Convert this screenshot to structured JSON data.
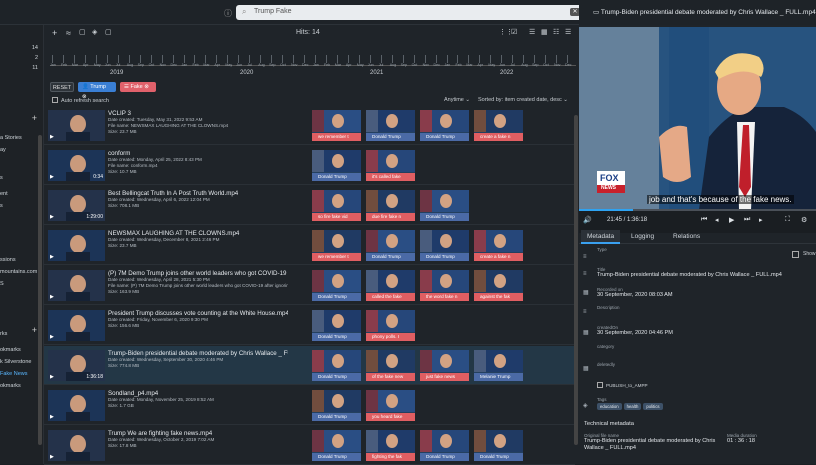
{
  "search": {
    "value": "Trump Fake"
  },
  "hits_label": "Hits: 14",
  "sidebar": {
    "rows": [
      {
        "label": "",
        "count": "14"
      },
      {
        "label": "",
        "count": "2"
      },
      {
        "label": "",
        "count": "11"
      },
      {
        "label": "a Stories",
        "count": ""
      },
      {
        "label": "ay",
        "count": ""
      },
      {
        "label": "s",
        "count": ""
      },
      {
        "label": "ent",
        "count": ""
      },
      {
        "label": "s",
        "count": ""
      },
      {
        "label": "ssions",
        "count": ""
      },
      {
        "label": "mountains.com",
        "count": ""
      },
      {
        "label": "S",
        "count": ""
      },
      {
        "label": "rks",
        "count": ""
      },
      {
        "label": "okmarks",
        "count": ""
      },
      {
        "label": "k Silverstone",
        "count": ""
      },
      {
        "label": "Fake News",
        "count": ""
      },
      {
        "label": "okmarks",
        "count": ""
      }
    ]
  },
  "timeline": {
    "years": [
      "2019",
      "2020",
      "2021",
      "2022"
    ],
    "months": [
      "Jan",
      "Feb",
      "Mar",
      "Apr",
      "May",
      "Jun",
      "Jul",
      "Aug",
      "Sep",
      "Oct",
      "Nov",
      "Dec",
      "Jan",
      "Feb",
      "Mar",
      "Apr",
      "May",
      "Jun",
      "Jul",
      "Aug",
      "Sep",
      "Oct",
      "Nov",
      "Dec",
      "Jan",
      "Feb",
      "Mar",
      "Apr",
      "May",
      "Jun",
      "Jul",
      "Aug",
      "Sep",
      "Oct",
      "Nov",
      "Dec",
      "Jan",
      "Feb",
      "Mar",
      "Apr",
      "May",
      "Jun",
      "Jul",
      "Aug",
      "Sep",
      "Oct",
      "Nov",
      "Dec"
    ]
  },
  "filters": {
    "reset": "RESET",
    "chip1": "Trump",
    "chip2": "Fake"
  },
  "auto_refresh": "Auto refresh search",
  "sort": {
    "range": "Anytime",
    "order": "Sorted by: item created date, desc"
  },
  "items": [
    {
      "title": "VCLIP 3",
      "created": "Date created: Tuesday, May 31, 2022 9:53 AM",
      "file": "File name: NEWSMAX LAUGHING AT THE CLOWNS.mp4",
      "size": "Size: 23.7 MB",
      "duration": "",
      "caps": [
        "we remember t",
        "Donald Trump",
        "Donald Trump",
        "create a fake n"
      ]
    },
    {
      "title": "conform",
      "created": "Date created: Monday, April 25, 2022 8:43 PM",
      "file": "File name: conform.mp4",
      "size": "Size: 10.7 MB",
      "duration": "0:34",
      "caps": [
        "Donald Trump",
        "it's called fake",
        "",
        ""
      ]
    },
    {
      "title": "Best Bellingcat Truth In A Post Truth World.mp4",
      "created": "Date created: Wednesday, April 6, 2022 12:04 PM",
      "file": "",
      "size": "Size: 708.1 MB",
      "duration": "1:29:00",
      "caps": [
        "so fire fake vid",
        "due fire fake n",
        "Donald Trump",
        ""
      ]
    },
    {
      "title": "NEWSMAX LAUGHING AT THE CLOWNS.mp4",
      "created": "Date created: Wednesday, December 8, 2021 2:46 PM",
      "file": "",
      "size": "Size: 23.7 MB",
      "duration": "",
      "caps": [
        "we remember t",
        "Donald Trump",
        "Donald Trump",
        "create a fake n"
      ]
    },
    {
      "title": "(P) 7M Demo Trump joins other world leaders who got COVID-19 aft...",
      "created": "Date created: Wednesday, April 28, 2021 5:30 PM",
      "file": "File name: (P) 7M Demo Trump joins other world leaders who got COVID-19 after ignorin...",
      "size": "Size: 163.9 MB",
      "duration": "",
      "caps": [
        "Donald Trump",
        "called the fake",
        "the word fake n",
        "against the fak"
      ]
    },
    {
      "title": "President Trump discusses vote counting at the White House.mp4",
      "created": "Date created: Friday, November 6, 2020 9:30 PM",
      "file": "",
      "size": "Size: 156.6 MB",
      "duration": "",
      "caps": [
        "Donald Trump",
        "phony polls. I",
        "",
        ""
      ]
    },
    {
      "title": "Trump-Biden presidential debate moderated by Chris Wallace _ FULL.mp4",
      "created": "Date created: Wednesday, September 30, 2020 4:46 PM",
      "file": "",
      "size": "Size: 774.8 MB",
      "duration": "1:36:18",
      "caps": [
        "Donald Trump",
        "of the fake new",
        "just fake news",
        "Melanie Trump"
      ]
    },
    {
      "title": "Sondland_p4.mp4",
      "created": "Date created: Monday, November 25, 2019 8:52 AM",
      "file": "",
      "size": "Size: 1.7 GB",
      "duration": "",
      "caps": [
        "Donald Trump",
        "you heard fake",
        "",
        ""
      ]
    },
    {
      "title": "Trump We are fighting fake news.mp4",
      "created": "Date created: Wednesday, October 2, 2019 7:02 AM",
      "file": "",
      "size": "Size: 17.8 MB",
      "duration": "",
      "caps": [
        "Donald Trump",
        "fighting the fak",
        "Donald Trump",
        "Donald Trump"
      ]
    }
  ],
  "right": {
    "title": "Trump-Biden presidential debate moderated by Chris Wallace _ FULL.mp4",
    "subtitle": "job and that's because of the fake news.",
    "logo_top": "FOX",
    "logo_bottom": "NEWS",
    "time": "21:45 / 1:36:18",
    "progress": 0.226,
    "tabs": [
      "Metadata",
      "Logging",
      "Relations"
    ],
    "show_label": "Show",
    "fields": {
      "type_k": "Type",
      "title_k": "Title",
      "title_v": "Trump-Biden presidential debate moderated by Chris Wallace _ FULL.mp4",
      "recorded_k": "Recorded on",
      "recorded_v": "30 September, 2020 08:03 AM",
      "desc_k": "Description",
      "created_k": "createdOn",
      "created_v": "30 September, 2020 04:46 PM",
      "category_k": "category",
      "deleted_k": "deletedly",
      "publish": "PUBLISH_to_AMPP",
      "tags_k": "Tags",
      "tags": [
        "education",
        "health",
        "politics"
      ],
      "tech": "Technical metadata",
      "orig_k": "Original file name",
      "orig_v": "Trump-Biden presidential debate moderated by Chris Wallace _ FULL.mp4",
      "dur_k": "Media duration",
      "dur_v": "01 : 36 : 18"
    }
  }
}
